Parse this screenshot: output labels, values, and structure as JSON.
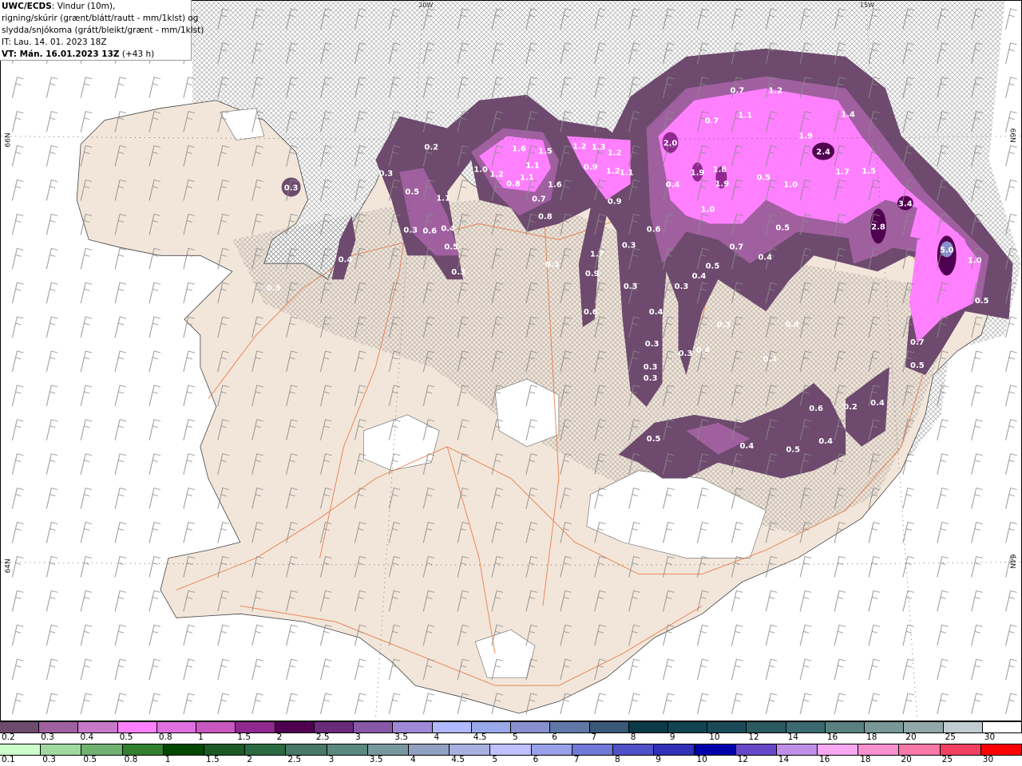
{
  "header": {
    "model": "UWC/ECDS",
    "line1_rest": ": Vindur (10m),",
    "line2": "rigning/skúrir (grænt/blátt/rautt - mm/1klst) og",
    "line3": "slydda/snjókoma (grátt/bleikt/grænt - mm/1klst)",
    "initial_time": "IT: Lau. 14. 01. 2023 18Z",
    "valid_label": "VT: Mán. 16.01.2023 13Z",
    "lead": " (+43 h)"
  },
  "grid_labels": {
    "lon_20": "20W",
    "lon_15": "15W",
    "lat_66_left": "66N",
    "lat_66_right": "66N",
    "lat_64_left": "64N",
    "lat_64_right": "64N"
  },
  "map": {
    "value_labels": [
      "0.2",
      "0.3",
      "0.5",
      "1.1",
      "0.3",
      "0.6",
      "0.4",
      "0.5",
      "0.3",
      "0.4",
      "1.0",
      "1.2",
      "0.8",
      "1.6",
      "1.5",
      "1.1",
      "1.1",
      "1.6",
      "0.7",
      "0.8",
      "1.2",
      "1.3",
      "1.2",
      "0.9",
      "1.2",
      "1.1",
      "0.9",
      "0.3",
      "1.7",
      "0.9",
      "0.6",
      "0.3",
      "0.3",
      "0.3",
      "0.3",
      "0.7",
      "1.2",
      "0.7",
      "1.1",
      "1.4",
      "2.0",
      "1.9",
      "2.4",
      "1.9",
      "1.8",
      "1.9",
      "0.4",
      "0.5",
      "1.0",
      "1.7",
      "1.5",
      "1.0",
      "3.4",
      "2.8",
      "0.6",
      "0.5",
      "0.7",
      "0.4",
      "5.0",
      "1.0",
      "0.5",
      "0.4",
      "0.5",
      "0.4",
      "0.3",
      "0.4",
      "0.3",
      "0.4",
      "0.3",
      "0.3",
      "0.3",
      "0.4",
      "0.7",
      "0.5",
      "0.2",
      "0.4",
      "0.6",
      "0.5",
      "0.4",
      "0.5",
      "0.4",
      "0.3"
    ],
    "colors": {
      "land": "#f2e6da",
      "sea": "#ffffff",
      "roads": "#e8703a",
      "glacier": "#ffffff",
      "barbs": "#888888"
    }
  },
  "snow_scale": {
    "labels": [
      "0.2",
      "0.3",
      "0.4",
      "0.5",
      "0.8",
      "1",
      "1.5",
      "2",
      "2.5",
      "3",
      "3.5",
      "4",
      "4.5",
      "5",
      "6",
      "7",
      "8",
      "9",
      "10",
      "12",
      "14",
      "16",
      "18",
      "20",
      "25",
      "30"
    ],
    "colors": [
      "#6e4a6e",
      "#a060a0",
      "#c878c8",
      "#ff80ff",
      "#e070e0",
      "#c858c0",
      "#902890",
      "#500050",
      "#6a2a7a",
      "#8858a8",
      "#a088d8",
      "#b0b8ff",
      "#98a8e8",
      "#8890d0",
      "#6078a8",
      "#3a5878",
      "#0a3a48",
      "#104450",
      "#1a4a58",
      "#2a5a60",
      "#3a6a70",
      "#5a8080",
      "#789898",
      "#90a8a8",
      "#c0ccd0",
      "#ffffff"
    ]
  },
  "rain_scale": {
    "labels": [
      "0.1",
      "0.3",
      "0.5",
      "0.8",
      "1",
      "1.5",
      "2",
      "2.5",
      "3",
      "3.5",
      "4",
      "4.5",
      "5",
      "6",
      "7",
      "8",
      "9",
      "10",
      "12",
      "14",
      "16",
      "18",
      "20",
      "25",
      "30"
    ],
    "colors": [
      "#ccffcc",
      "#a0d8a0",
      "#70b070",
      "#308030",
      "#004800",
      "#1a5a24",
      "#2a6a40",
      "#487868",
      "#5a8880",
      "#7898a0",
      "#90a0c0",
      "#a8b0e0",
      "#c0c0ff",
      "#98a0e8",
      "#7078d8",
      "#5050c8",
      "#3030b8",
      "#0000a8",
      "#6848c8",
      "#c090e8",
      "#f8a8f0",
      "#f890d0",
      "#f878a8",
      "#f04060",
      "#ff0000"
    ]
  }
}
